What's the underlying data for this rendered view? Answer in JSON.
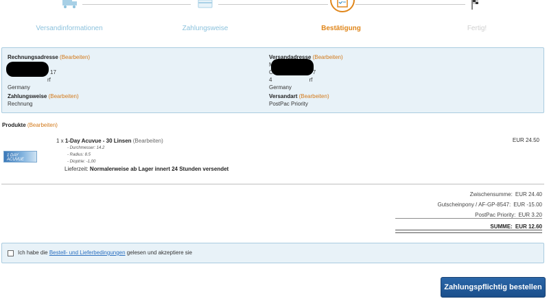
{
  "steps": [
    {
      "label": "Versandinformationen"
    },
    {
      "label": "Zahlungsweise"
    },
    {
      "label": "Bestätigung"
    },
    {
      "label": "Fertig!"
    }
  ],
  "billing": {
    "title": "Rechnungsadresse",
    "edit": "(Bearbeiten)",
    "line1_tail": "17",
    "line2_tail": "rf",
    "country": "Germany"
  },
  "shipping": {
    "title": "Versandadresse",
    "edit": "(Bearbeiten)",
    "line1_head": "M",
    "line2_head": "C",
    "line2_tail": "7",
    "line3_head": "4",
    "line3_tail": "rf",
    "country": "Germany"
  },
  "payment": {
    "title": "Zahlungsweise",
    "edit": "(Bearbeiten)",
    "value": "Rechnung"
  },
  "shipping_method": {
    "title": "Versandart",
    "edit": "(Bearbeiten)",
    "value": "PostPac Priority"
  },
  "products": {
    "title": "Produkte",
    "edit": "(Bearbeiten)",
    "image_text": "1 DAY ACUVUE",
    "items": [
      {
        "qty": "1 x",
        "name": "1-Day Acuvue - 30 Linsen",
        "edit": "(Bearbeiten)",
        "attrs": [
          "- Durchmesser: 14.2",
          "- Radius: 8.5",
          "- Dioptrie: -1,00"
        ],
        "delivery_label": "Lieferzeit:",
        "delivery_value": "Normalerweise ab Lager innert 24 Stunden versendet",
        "price": "EUR 24.50"
      }
    ]
  },
  "totals": {
    "subtotal_label": "Zwischensumme:",
    "subtotal_value": "EUR 24.40",
    "voucher_label": "Gutscheinpony / AF-GP-8547:",
    "voucher_value": "EUR -15.00",
    "shipping_label": "PostPac Priority:",
    "shipping_value": "EUR 3.20",
    "sum_label": "SUMME:",
    "sum_value": "EUR 12.60"
  },
  "agreement": {
    "before": "Ich habe die ",
    "link": "Bestell- und Lieferbedingungen",
    "after": " gelesen und akzeptiere sie"
  },
  "order_button": "Zahlungspflichtig bestellen"
}
